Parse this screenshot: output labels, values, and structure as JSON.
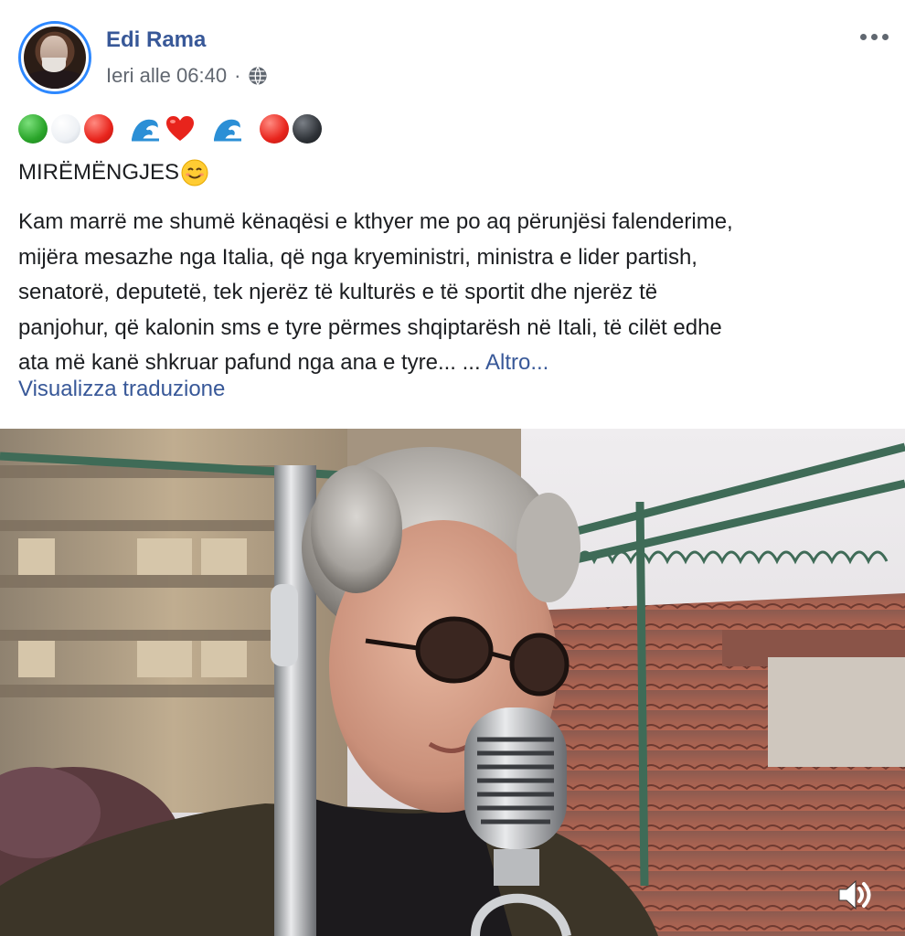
{
  "post": {
    "author": "Edi Rama",
    "timestamp": "Ieri alle 06:40",
    "separator": "·",
    "audience_icon": "globe-icon",
    "more_icon": "more-options-icon"
  },
  "emoji_line": {
    "items": [
      "green-circle",
      "white-circle",
      "red-circle",
      "water-wave",
      "red-heart",
      "water-wave",
      "red-circle",
      "black-circle"
    ]
  },
  "greeting": {
    "text": "MIRËMËNGJES",
    "emoji": "smiling-face-icon"
  },
  "body": {
    "lines": [
      "Kam marrë me shumë kënaqësi e kthyer me po aq përunjësi falenderime,",
      "mijëra mesazhe nga Italia, që nga kryeministri, ministra e lider partish,",
      "senatorë, deputetë, tek njerëz të kulturës e të sportit dhe njerëz të",
      "panjohur, që kalonin sms e tyre përmes shqiptarësh në Itali, të cilët edhe",
      "ata më kanë shkruar pafund nga ana e tyre... ..."
    ],
    "see_more": "Altro..."
  },
  "translate": {
    "label": "Visualizza traduzione"
  },
  "video": {
    "volume_icon": "volume-icon",
    "colors": {
      "sky": "#e6e3e6",
      "building": "#b9a588",
      "roof": "#a0584a",
      "railing": "#3f6b57"
    }
  }
}
